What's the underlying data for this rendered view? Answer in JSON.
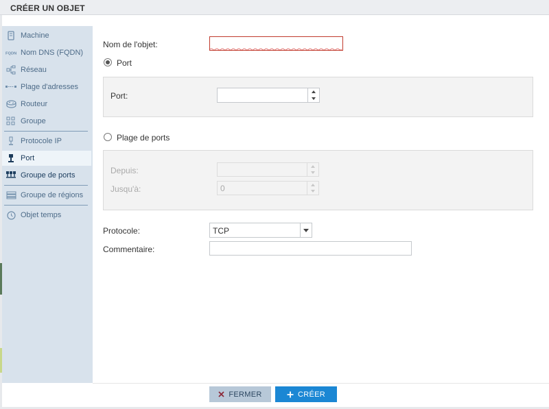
{
  "dialog": {
    "title": "CRÉER UN OBJET"
  },
  "sidebar": {
    "items": [
      {
        "label": "Machine",
        "icon": "server-icon"
      },
      {
        "label": "Nom DNS (FQDN)",
        "icon": "fqdn-icon"
      },
      {
        "label": "Réseau",
        "icon": "network-icon"
      },
      {
        "label": "Plage d'adresses",
        "icon": "address-range-icon"
      },
      {
        "label": "Routeur",
        "icon": "router-icon"
      },
      {
        "label": "Groupe",
        "icon": "group-icon"
      },
      {
        "label": "Protocole IP",
        "icon": "protocol-icon"
      },
      {
        "label": "Port",
        "icon": "port-icon",
        "active": true
      },
      {
        "label": "Groupe de ports",
        "icon": "port-group-icon"
      },
      {
        "label": "Groupe de régions",
        "icon": "region-group-icon"
      },
      {
        "label": "Objet temps",
        "icon": "clock-icon"
      }
    ]
  },
  "form": {
    "name_label": "Nom de l'objet:",
    "name_value": "",
    "port_radio_label": "Port",
    "port_field_label": "Port:",
    "port_value": "",
    "range_radio_label": "Plage de ports",
    "from_label": "Depuis:",
    "from_value": "",
    "to_label": "Jusqu'à:",
    "to_value": "0",
    "protocol_label": "Protocole:",
    "protocol_value": "TCP",
    "comment_label": "Commentaire:",
    "comment_value": ""
  },
  "buttons": {
    "close": "FERMER",
    "create": "CRÉER"
  },
  "colors": {
    "accent": "#1b87d4",
    "close_button": "#b7c8d8",
    "sidebar_bg": "#d8e2ec",
    "error_border": "#c0392b"
  }
}
